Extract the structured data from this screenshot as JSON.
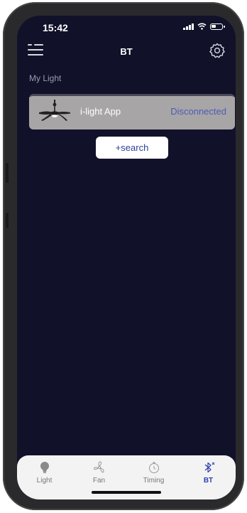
{
  "status_bar": {
    "time": "15:42"
  },
  "header": {
    "title": "BT"
  },
  "section": {
    "label": "My Light"
  },
  "device": {
    "name": "i-light App",
    "status": "Disconnected"
  },
  "search": {
    "label": "+search"
  },
  "tabs": [
    {
      "label": "Light",
      "icon": "bulb-icon"
    },
    {
      "label": "Fan",
      "icon": "fan-icon"
    },
    {
      "label": "Timing",
      "icon": "timer-icon"
    },
    {
      "label": "BT",
      "icon": "bluetooth-icon"
    }
  ],
  "colors": {
    "background": "#11112a",
    "card": "#a8a5a7",
    "accent": "#2b3fb0",
    "status_text": "#4a5db4"
  }
}
